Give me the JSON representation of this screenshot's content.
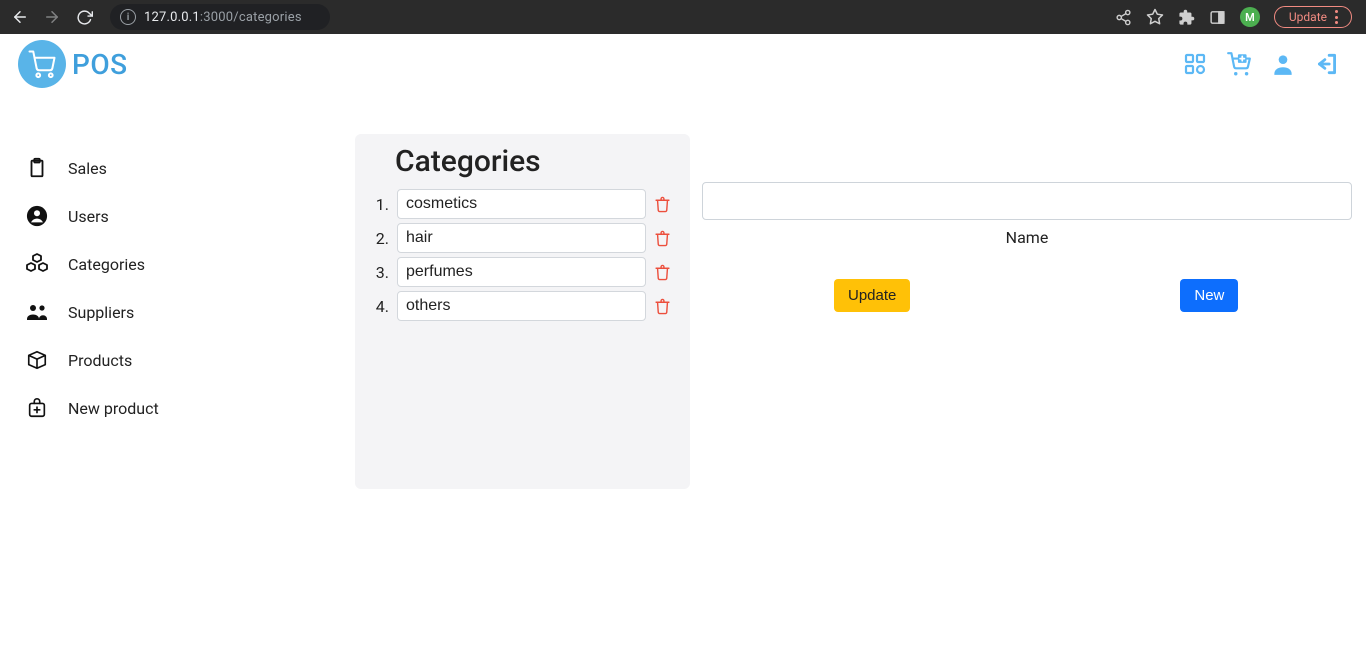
{
  "browser": {
    "url_host": "127.0.0.1",
    "url_rest": ":3000/categories",
    "avatar_initial": "M",
    "update_label": "Update"
  },
  "brand": {
    "name": "POS"
  },
  "sidebar": {
    "items": [
      {
        "label": "Sales"
      },
      {
        "label": "Users"
      },
      {
        "label": "Categories"
      },
      {
        "label": "Suppliers"
      },
      {
        "label": "Products"
      },
      {
        "label": "New product"
      }
    ]
  },
  "categories": {
    "title": "Categories",
    "items": [
      {
        "num": "1.",
        "name": "cosmetics"
      },
      {
        "num": "2.",
        "name": "hair"
      },
      {
        "num": "3.",
        "name": "perfumes"
      },
      {
        "num": "4.",
        "name": "others"
      }
    ]
  },
  "form": {
    "name_label": "Name",
    "name_value": "",
    "update_label": "Update",
    "new_label": "New"
  }
}
